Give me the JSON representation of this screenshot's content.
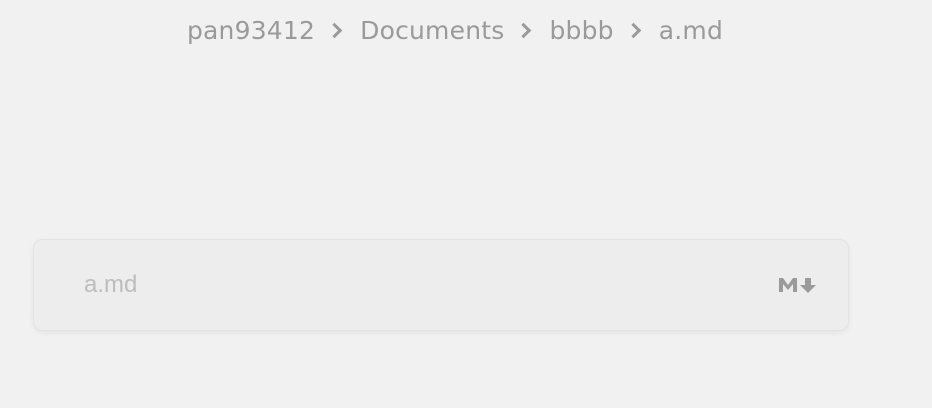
{
  "breadcrumb": {
    "items": [
      "pan93412",
      "Documents",
      "bbbb",
      "a.md"
    ]
  },
  "file": {
    "name": "a.md",
    "type_icon": "markdown-icon"
  },
  "colors": {
    "background": "#f1f1f1",
    "text_muted": "#9a9a9a",
    "placeholder": "#bdbdbd"
  }
}
